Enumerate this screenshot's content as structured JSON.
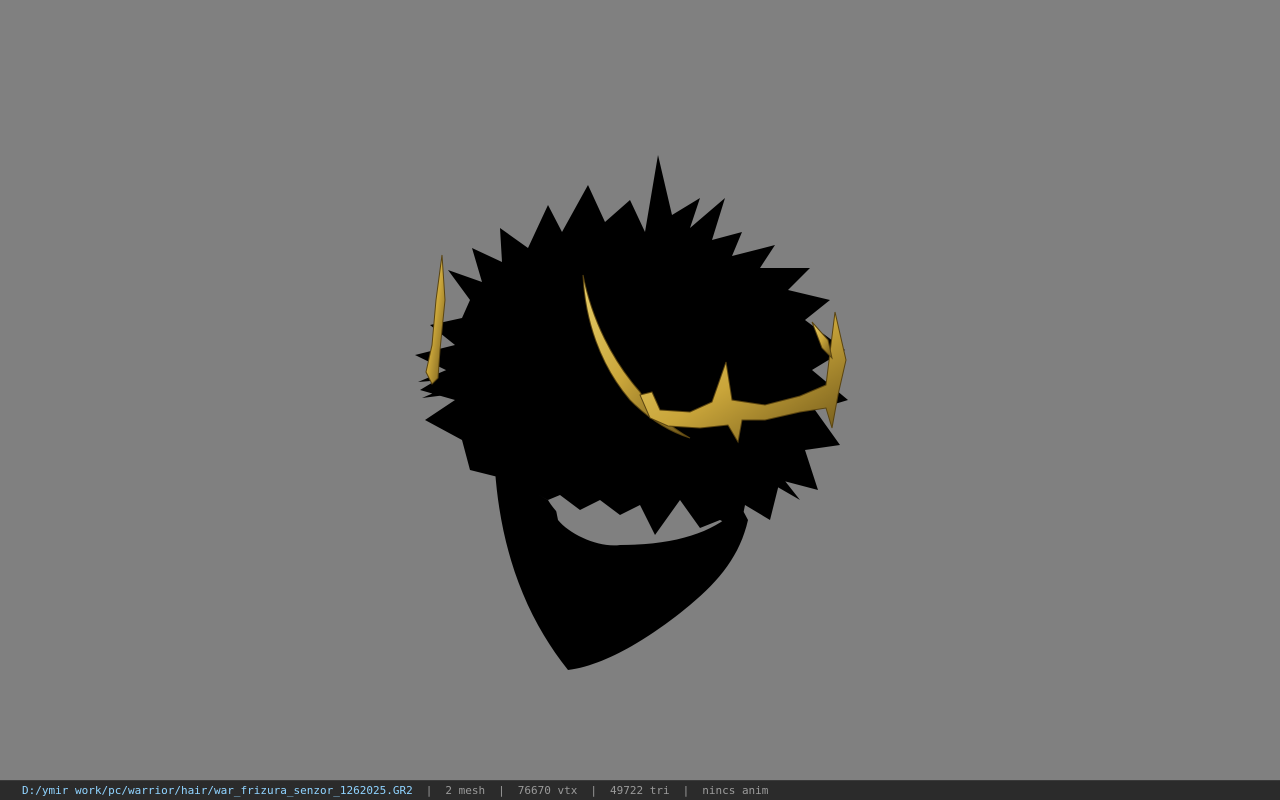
{
  "viewport": {
    "background_color": "#808080",
    "model": {
      "hair_color": "#000000",
      "ornament_color": "#c9a53a",
      "ornament_highlight": "#e8cf6a",
      "ornament_shadow": "#6b5418"
    }
  },
  "status_bar": {
    "file_path": "D:/ymir work/pc/warrior/hair/war_frizura_senzor_1262025.GR2",
    "separator": "|",
    "mesh_count": "2 mesh",
    "vertex_count": "76670 vtx",
    "triangle_count": "49722 tri",
    "animation": "nincs anim",
    "path_color": "#8fd3ff",
    "text_color": "#9a9a9a"
  }
}
